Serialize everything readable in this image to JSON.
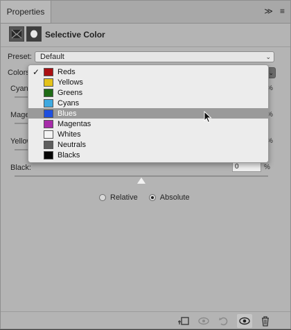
{
  "panel": {
    "tab_label": "Properties",
    "tab_menu_glyph": "≫",
    "tab_options_glyph": "≡",
    "title": "Selective Color"
  },
  "preset": {
    "label": "Preset:",
    "value": "Default"
  },
  "colors": {
    "label": "Colors"
  },
  "sliders": [
    {
      "label": "Cyan"
    },
    {
      "label": "Mage"
    },
    {
      "label": "Yellow"
    },
    {
      "label": "Black:",
      "value": "0",
      "unit": "%",
      "level": 0.5
    }
  ],
  "method": {
    "options": [
      "Relative",
      "Absolute"
    ],
    "selected": "Absolute"
  },
  "dropdown": {
    "items": [
      {
        "label": "Reds",
        "color": "#aa0f12",
        "checked": true
      },
      {
        "label": "Yellows",
        "color": "#e4c21a"
      },
      {
        "label": "Greens",
        "color": "#1f6b16"
      },
      {
        "label": "Cyans",
        "color": "#3fa9e0"
      },
      {
        "label": "Blues",
        "color": "#1d4fe0",
        "highlighted": true
      },
      {
        "label": "Magentas",
        "color": "#a62ba9"
      },
      {
        "label": "Whites",
        "color": "#f4f4f4"
      },
      {
        "label": "Neutrals",
        "color": "#5e5e5e"
      },
      {
        "label": "Blacks",
        "color": "#050505"
      }
    ],
    "check_glyph": "✓"
  },
  "footer": {
    "icons": [
      "clip-to-layer-icon",
      "view-previous-icon",
      "reset-icon",
      "visibility-eye-icon",
      "trash-icon"
    ]
  }
}
